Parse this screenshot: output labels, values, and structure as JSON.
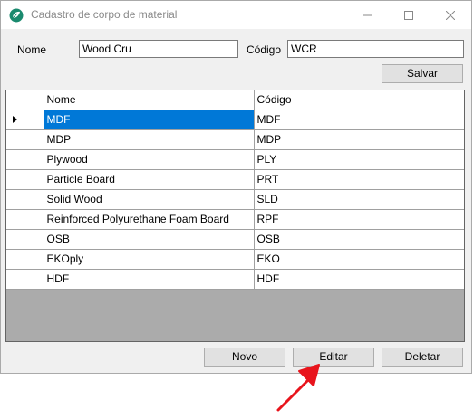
{
  "window": {
    "title": "Cadastro de corpo de material",
    "minimize_icon": "minimize-icon",
    "maximize_icon": "maximize-icon",
    "close_icon": "close-icon"
  },
  "form": {
    "nome_label": "Nome",
    "nome_value": "Wood Cru",
    "codigo_label": "Código",
    "codigo_value": "WCR",
    "salvar_label": "Salvar"
  },
  "grid": {
    "columns": [
      "Nome",
      "Código"
    ],
    "selected_row": 0,
    "rows": [
      {
        "nome": "MDF",
        "codigo": "MDF"
      },
      {
        "nome": "MDP",
        "codigo": "MDP"
      },
      {
        "nome": "Plywood",
        "codigo": "PLY"
      },
      {
        "nome": "Particle Board",
        "codigo": "PRT"
      },
      {
        "nome": "Solid Wood",
        "codigo": "SLD"
      },
      {
        "nome": "Reinforced Polyurethane Foam Board",
        "codigo": "RPF"
      },
      {
        "nome": "OSB",
        "codigo": "OSB"
      },
      {
        "nome": "EKOply",
        "codigo": "EKO"
      },
      {
        "nome": "HDF",
        "codigo": "HDF"
      }
    ]
  },
  "footer": {
    "novo_label": "Novo",
    "editar_label": "Editar",
    "deletar_label": "Deletar"
  },
  "colors": {
    "selection": "#0078d7",
    "annotation_arrow": "#e8141c"
  }
}
